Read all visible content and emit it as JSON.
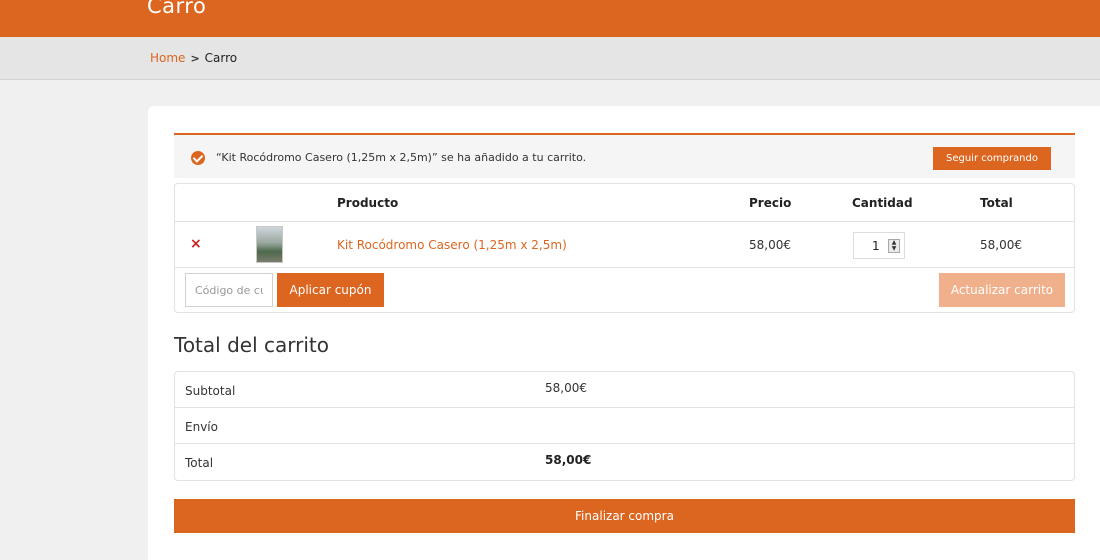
{
  "header": {
    "title": "Carro"
  },
  "breadcrumb": {
    "home": "Home",
    "separator": ">",
    "current": "Carro"
  },
  "notice": {
    "message": "“Kit Rocódromo Casero (1,25m x 2,5m)” se ha añadido a tu carrito.",
    "button": "Seguir comprando",
    "icon": "check-circle-icon"
  },
  "cart": {
    "headers": {
      "product": "Producto",
      "price": "Precio",
      "quantity": "Cantidad",
      "total": "Total"
    },
    "items": [
      {
        "remove": "×",
        "name": "Kit Rocódromo Casero (1,25m x 2,5m)",
        "price": "58,00€",
        "quantity": "1",
        "total": "58,00€"
      }
    ],
    "coupon_placeholder": "Código de cupón",
    "apply_coupon": "Aplicar cupón",
    "update_cart": "Actualizar carrito"
  },
  "totals": {
    "title": "Total del carrito",
    "subtotal_label": "Subtotal",
    "subtotal_value": "58,00€",
    "shipping_label": "Envío",
    "total_label": "Total",
    "total_value": "58,00€"
  },
  "checkout_button": "Finalizar compra",
  "colors": {
    "accent": "#dc661f",
    "accent_disabled": "#efb08b",
    "remove": "#d02020"
  }
}
